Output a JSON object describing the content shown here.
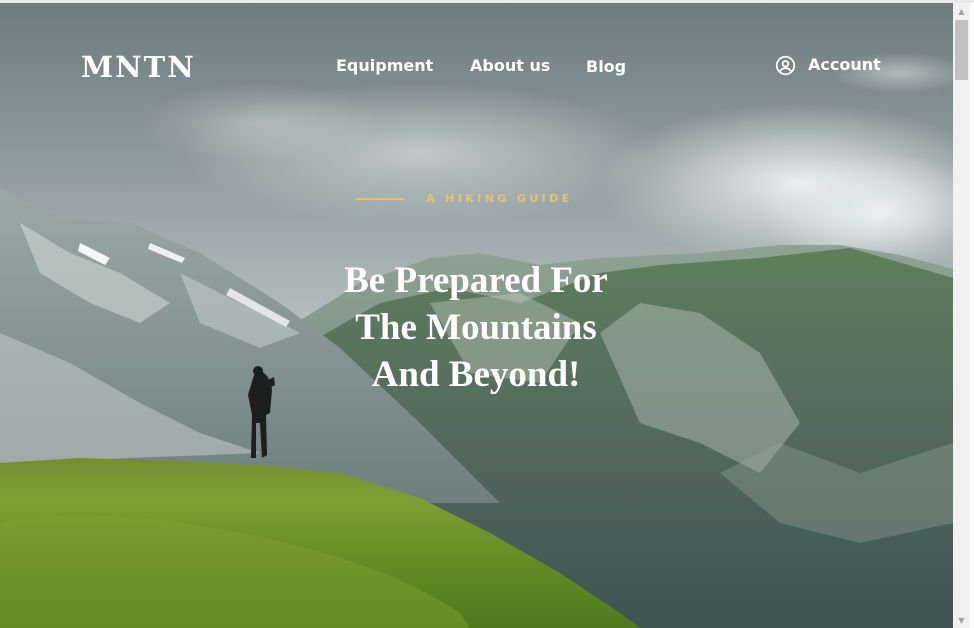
{
  "site": {
    "logo": "MNTN"
  },
  "nav": {
    "equipment": "Equipment",
    "about": "About us",
    "blog": "Blog"
  },
  "account": {
    "label": "Account",
    "icon": "user-circle-icon"
  },
  "hero": {
    "eyebrow": "A HIKING GUIDE",
    "headline": "Be Prepared For The Mountains And Beyond!"
  },
  "colors": {
    "accent": "#e8c070",
    "text": "#ffffff"
  }
}
